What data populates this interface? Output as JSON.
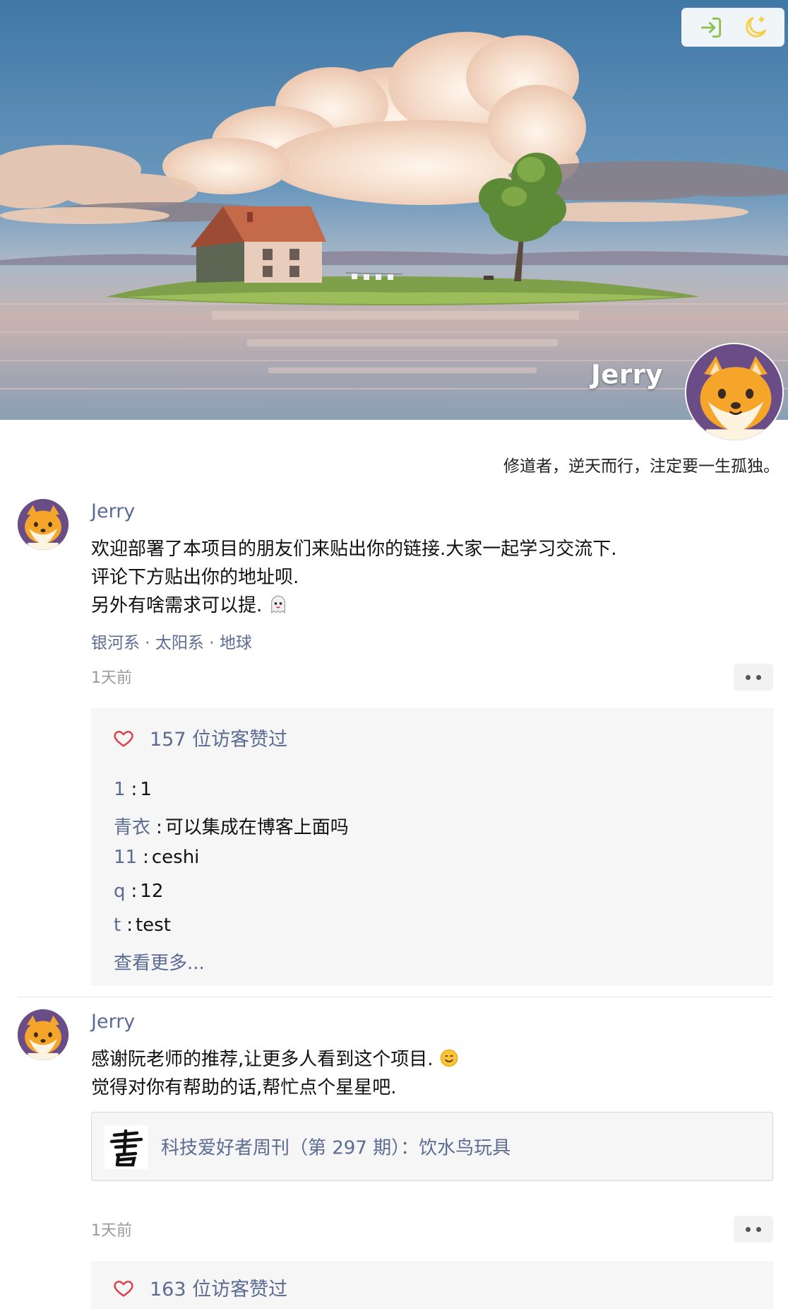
{
  "header": {
    "name": "Jerry",
    "motto": "修道者，逆天而行，注定要一生孤独。",
    "icons": {
      "login": "login-icon",
      "theme": "moon-icon"
    },
    "colors": {
      "login_icon": "#8cc152",
      "moon_icon": "#f5d04a"
    }
  },
  "posts": [
    {
      "author": "Jerry",
      "lines": [
        "欢迎部署了本项目的朋友们来贴出你的链接.大家一起学习交流下.",
        "评论下方贴出你的地址呗.",
        "另外有啥需求可以提."
      ],
      "emoji": "ghost-emoji",
      "location": "银河系 · 太阳系 · 地球",
      "time": "1天前",
      "likes": "157 位访客赞过",
      "comments": [
        {
          "user": "1",
          "sep": ":",
          "text": "1"
        },
        {
          "user": "青衣",
          "sep": ":",
          "text": "可以集成在博客上面吗"
        },
        {
          "user": "11",
          "sep": ":",
          "text": "ceshi"
        },
        {
          "user": "q",
          "sep": ":",
          "text": "12"
        },
        {
          "user": "t",
          "sep": ":",
          "text": "test"
        }
      ],
      "see_more": "查看更多..."
    },
    {
      "author": "Jerry",
      "lines": [
        "感谢阮老师的推荐,让更多人看到这个项目.",
        "觉得对你有帮助的话,帮忙点个星星吧."
      ],
      "emoji": "smile-emoji",
      "link_title": "科技爱好者周刊（第 297 期）：饮水鸟玩具",
      "time": "1天前",
      "likes": "163 位访客赞过"
    }
  ],
  "colors": {
    "link": "#5b6b93",
    "heart": "#d9434b",
    "box_bg": "#f6f6f6"
  }
}
